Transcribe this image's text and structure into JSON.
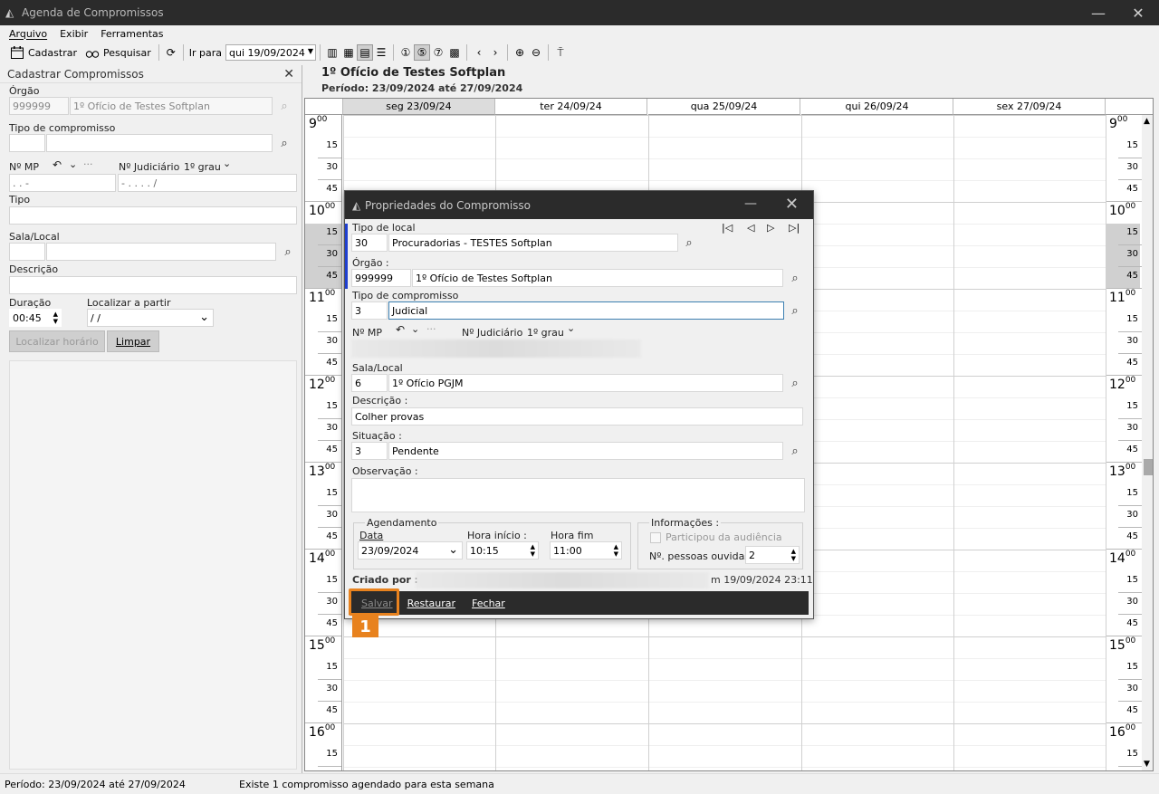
{
  "window": {
    "title": "Agenda de Compromissos",
    "minimize": "—",
    "close": "✕"
  },
  "menu": {
    "arquivo": "Arquivo",
    "exibir": "Exibir",
    "ferramentas": "Ferramentas"
  },
  "toolbar": {
    "cadastrar": "Cadastrar",
    "pesquisar": "Pesquisar",
    "ir_para": "Ir para",
    "date": "qui 19/09/2024"
  },
  "left": {
    "header": "Cadastrar Compromissos",
    "orgao_label": "Órgão",
    "orgao_code": "999999",
    "orgao_name": "1º Ofício de Testes Softplan",
    "tipo_comp_label": "Tipo de compromisso",
    "nmp_label": "Nº MP",
    "nmp_value": ".  .     -",
    "njud_label": "Nº Judiciário",
    "grau": "1º grau",
    "njud_value": "-  .  .  .  .   /",
    "tipo_label": "Tipo",
    "sala_label": "Sala/Local",
    "descricao_label": "Descrição",
    "duracao_label": "Duração",
    "duracao_value": "00:45",
    "localizar_label": "Localizar a partir",
    "localizar_value": " /  /",
    "btn_localizar": "Localizar horário",
    "btn_limpar": "Limpar"
  },
  "calendar": {
    "title": "1º Ofício de Testes Softplan",
    "period": "Período: 23/09/2024 até 27/09/2024",
    "days": [
      "seg 23/09/24",
      "ter 24/09/24",
      "qua 25/09/24",
      "qui 26/09/24",
      "sex 27/09/24"
    ],
    "hours": [
      "9",
      "10",
      "11",
      "12",
      "13",
      "14",
      "15",
      "16"
    ],
    "hour_sup": "00",
    "minutes": [
      "15",
      "30",
      "45"
    ]
  },
  "dialog": {
    "title": "Propriedades do Compromisso",
    "tipo_local_label": "Tipo de local",
    "tipo_local_code": "30",
    "tipo_local_name": "Procuradorias - TESTES Softplan",
    "orgao_label": "Órgão :",
    "orgao_code": "999999",
    "orgao_name": "1º Ofício de Testes Softplan",
    "tipo_comp_label": "Tipo de compromisso",
    "tipo_comp_code": "3",
    "tipo_comp_name": "Judicial",
    "nmp_label": "Nº MP",
    "njud_label": "Nº Judiciário",
    "grau": "1º grau",
    "sala_label": "Sala/Local",
    "sala_code": "6",
    "sala_name": "1º Ofício PGJM",
    "descricao_label": "Descrição :",
    "descricao_value": "Colher provas",
    "situacao_label": "Situação :",
    "situacao_code": "3",
    "situacao_name": "Pendente",
    "observacao_label": "Observação :",
    "agendamento_label": "Agendamento",
    "data_label": "Data",
    "data_value": "23/09/2024",
    "hora_inicio_label": "Hora início :",
    "hora_inicio_value": "10:15",
    "hora_fim_label": "Hora fim",
    "hora_fim_value": "11:00",
    "informacoes_label": "Informações :",
    "participou_label": "Participou da audiência",
    "pessoas_label": "Nº. pessoas ouvidas :",
    "pessoas_value": "2",
    "criado_label": "Criado por : N",
    "criado_suffix": "m 19/09/2024 23:11",
    "btn_salvar": "Salvar",
    "btn_restaurar": "Restaurar",
    "btn_fechar": "Fechar",
    "step_badge": "1"
  },
  "status": {
    "period": "Período: 23/09/2024 até 27/09/2024",
    "message": "Existe 1 compromisso agendado para esta semana"
  },
  "colors": {
    "accent": "#e8821e",
    "titlebar": "#2b2b2b",
    "focus": "#3c7fb1"
  }
}
